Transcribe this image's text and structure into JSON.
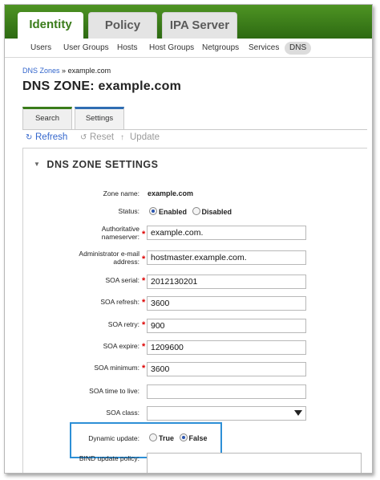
{
  "top_tabs": [
    {
      "label": "Identity",
      "active": true
    },
    {
      "label": "Policy",
      "active": false
    },
    {
      "label": "IPA Server",
      "active": false
    }
  ],
  "sub_nav": [
    "Users",
    "User Groups",
    "Hosts",
    "Host Groups",
    "Netgroups",
    "Services",
    "DNS"
  ],
  "breadcrumb": {
    "link": "DNS Zones",
    "separator": "»",
    "current": "example.com"
  },
  "page_title": "DNS ZONE: example.com",
  "facet_tabs": {
    "search": "Search",
    "settings": "Settings"
  },
  "actions": {
    "refresh": "Refresh",
    "reset": "Reset",
    "update": "Update"
  },
  "section_title": "DNS ZONE SETTINGS",
  "fields": {
    "zone_name": {
      "label": "Zone name:",
      "value": "example.com"
    },
    "status": {
      "label": "Status:",
      "enabled": "Enabled",
      "disabled": "Disabled",
      "selected": "Enabled"
    },
    "auth_ns": {
      "label1": "Authoritative",
      "label2": "nameserver:",
      "value": "example.com."
    },
    "admin_email": {
      "label1": "Administrator e-mail",
      "label2": "address:",
      "value": "hostmaster.example.com."
    },
    "soa_serial": {
      "label": "SOA serial:",
      "value": "2012130201"
    },
    "soa_refresh": {
      "label": "SOA refresh:",
      "value": "3600"
    },
    "soa_retry": {
      "label": "SOA retry:",
      "value": "900"
    },
    "soa_expire": {
      "label": "SOA expire:",
      "value": "1209600"
    },
    "soa_minimum": {
      "label": "SOA minimum:",
      "value": "3600"
    },
    "soa_ttl": {
      "label": "SOA time to live:",
      "value": ""
    },
    "soa_class": {
      "label": "SOA class:",
      "value": ""
    },
    "dynamic_update": {
      "label": "Dynamic update:",
      "true_label": "True",
      "false_label": "False",
      "selected": "False"
    },
    "bind_policy": {
      "label": "BIND update policy:"
    }
  },
  "colors": {
    "brand_green": "#3a7c1a",
    "link_blue": "#3366cc",
    "highlight": "#2d8fd6",
    "required": "#dd0000"
  }
}
